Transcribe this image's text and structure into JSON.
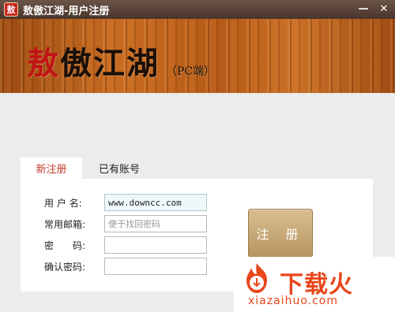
{
  "window": {
    "title": "敖傲江湖-用户注册",
    "icon_char": "敖",
    "minimize": "—",
    "close": "✕"
  },
  "banner": {
    "logo_first": "敖",
    "logo_rest": "傲江湖",
    "logo_sub": "（PC端）"
  },
  "tabs": [
    {
      "label": "新注册",
      "active": true
    },
    {
      "label": "已有账号",
      "active": false
    }
  ],
  "form": {
    "username": {
      "label": "用 户 名:",
      "value": "www.downcc.com"
    },
    "email": {
      "label": "常用邮箱:",
      "placeholder": "便于找回密码"
    },
    "password": {
      "label": "密　　码:",
      "value": ""
    },
    "confirm": {
      "label": "确认密码:",
      "value": ""
    },
    "register_button": "注 册"
  },
  "watermark": {
    "text": "下载火",
    "url": "xiazaihuo.com"
  },
  "colors": {
    "titlebar": "#4f392e",
    "tab_active_text": "#c0392b",
    "button": "#c6a674",
    "watermark": "#e8461b"
  }
}
